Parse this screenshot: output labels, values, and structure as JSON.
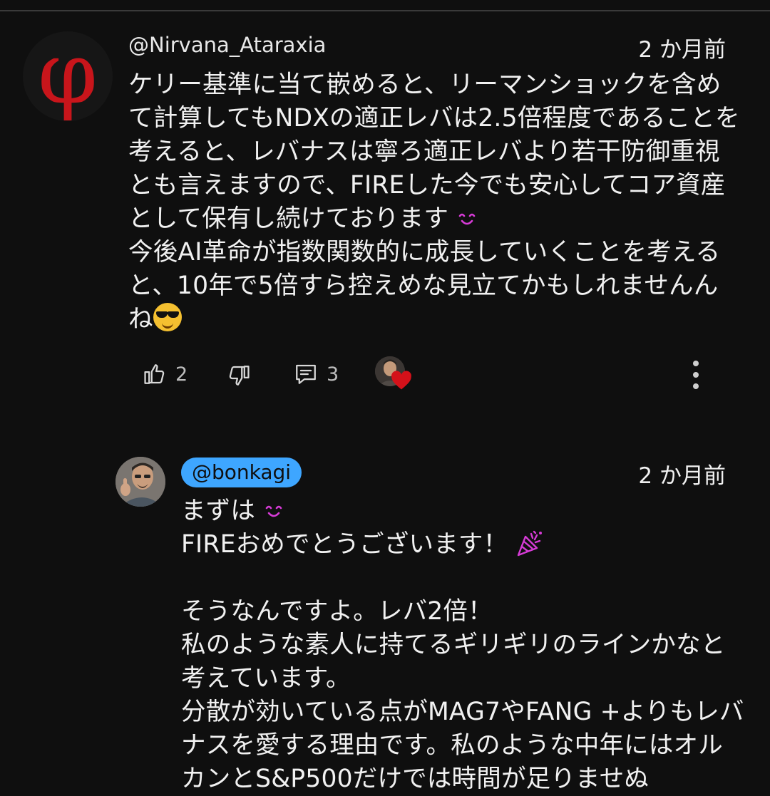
{
  "comment": {
    "avatar_glyph": "φ",
    "author": "@Nirvana_Ataraxia",
    "time": "2 か月前",
    "lines": [
      "ケリー基準に当て嵌めると、リーマンショックを含めて計算してもNDXの適正レバは2.5倍程度であることを考えると、レバナスは寧ろ適正レバより若干防御重視とも言えますので、FIREした今でも安心してコア資産として保有し続けております",
      "今後AI革命が指数関数的に成長していくことを考えると、10年で5倍すら控えめな見立てかもしれませんんね"
    ],
    "emojis": [
      "smiling-face-icon",
      "sunglasses-face-icon"
    ],
    "like_count": "2",
    "reply_count": "3",
    "colors": {
      "avatar_bg": "#161616",
      "phi": "#c8151b",
      "heart": "#d4111a"
    }
  },
  "reply": {
    "author": "@bonkagi",
    "time": "2 か月前",
    "lines": [
      "まずは",
      "FIREおめでとうございます！",
      "",
      "そうなんですよ。レバ2倍！",
      "私のような素人に持てるギリギリのラインかなと考えています。",
      "分散が効いている点がMAG7やFANG +よりもレバナスを愛する理由です。私のような中年にはオルカンとS&P500だけでは時間が足りませぬ"
    ],
    "emojis": [
      "smiling-face-icon",
      "party-popper-icon"
    ],
    "colors": {
      "handle_bg": "#3ea6ff",
      "emoji": "#d63bd6"
    }
  },
  "theme": {
    "background": "#0f0f0f",
    "text": "#f1f1f1",
    "muted": "#bdbdbd"
  }
}
